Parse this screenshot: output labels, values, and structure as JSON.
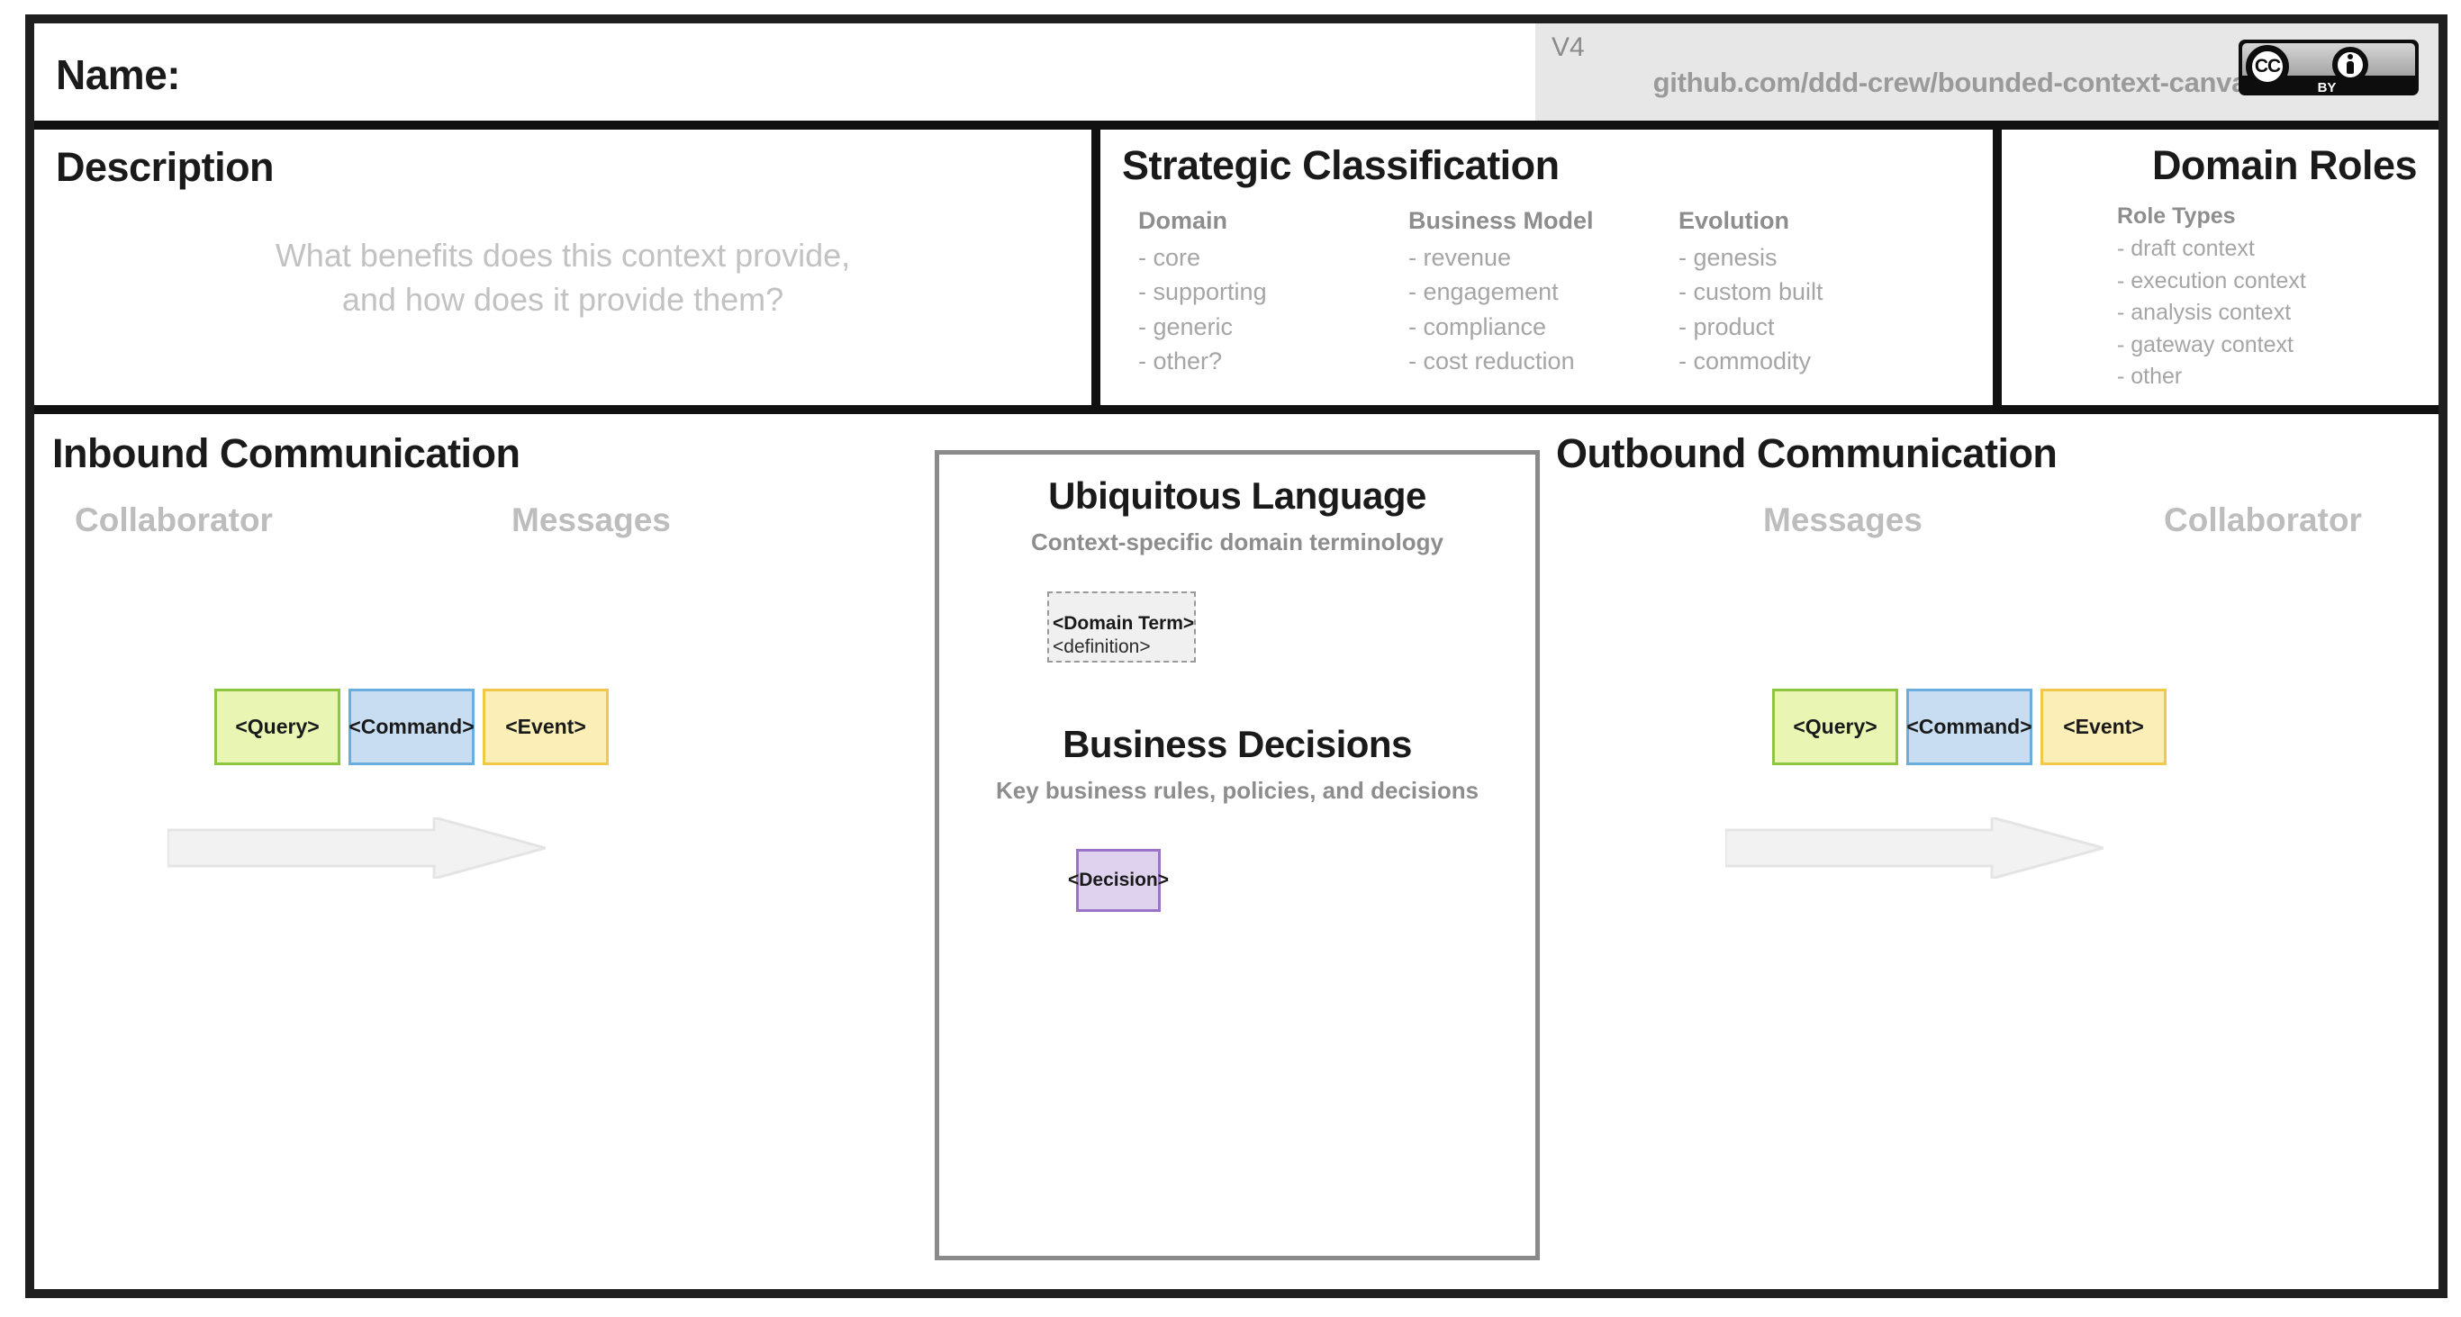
{
  "header": {
    "name_label": "Name:",
    "version": "V4",
    "url": "github.com/ddd-crew/bounded-context-canvas",
    "license": {
      "badge_name": "CC BY",
      "cc_glyph": "CC",
      "by_text": "BY"
    }
  },
  "description": {
    "title": "Description",
    "hint_line1": "What benefits does this context provide,",
    "hint_line2": "and how does it provide them?"
  },
  "strategic_classification": {
    "title": "Strategic Classification",
    "columns": [
      {
        "head": "Domain",
        "items": [
          "- core",
          "- supporting",
          "- generic",
          "- other?"
        ]
      },
      {
        "head": "Business Model",
        "items": [
          "- revenue",
          "- engagement",
          "- compliance",
          "- cost reduction"
        ]
      },
      {
        "head": "Evolution",
        "items": [
          "- genesis",
          "- custom built",
          "- product",
          "- commodity"
        ]
      }
    ]
  },
  "domain_roles": {
    "title": "Domain Roles",
    "head": "Role Types",
    "items": [
      "- draft context",
      "- execution context",
      "- analysis context",
      "- gateway context",
      "- other"
    ]
  },
  "inbound": {
    "title": "Inbound Communication",
    "left_label": "Collaborator",
    "right_label": "Messages",
    "messages": [
      "<Query>",
      "<Command>",
      "<Event>"
    ]
  },
  "outbound": {
    "title": "Outbound Communication",
    "left_label": "Messages",
    "right_label": "Collaborator",
    "messages": [
      "<Query>",
      "<Command>",
      "<Event>"
    ]
  },
  "ubiquitous_language": {
    "title": "Ubiquitous Language",
    "subtitle": "Context-specific domain terminology",
    "term": "<Domain Term>",
    "definition": "<definition>"
  },
  "business_decisions": {
    "title": "Business Decisions",
    "subtitle": "Key business rules, policies, and decisions",
    "decision": "<Decision>"
  },
  "colors": {
    "query": "#e8f5b3",
    "query_border": "#8ec63f",
    "command": "#c8ddf1",
    "command_border": "#6aaee0",
    "event": "#fbeeb6",
    "event_border": "#f2c84b",
    "decision": "#ded2ee",
    "decision_border": "#9b74c9",
    "frame": "#1f1f1f",
    "muted_text": "#a5a5a5"
  }
}
